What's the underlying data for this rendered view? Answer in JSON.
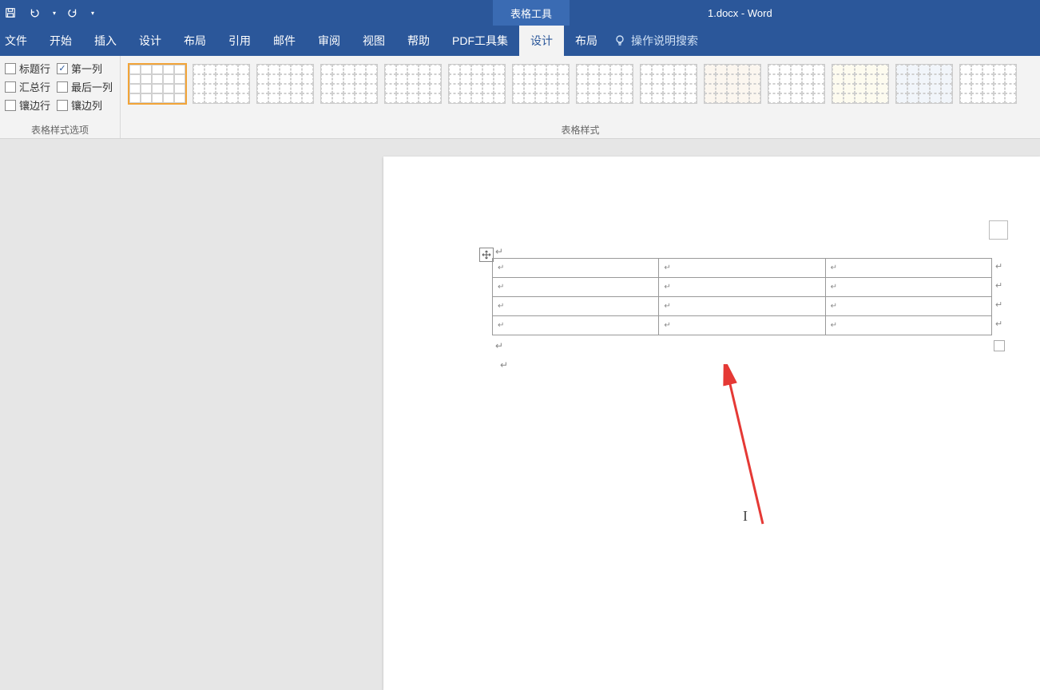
{
  "titlebar": {
    "context_tab": "表格工具",
    "doc_title": "1.docx  -  Word"
  },
  "ribbon": {
    "tabs": {
      "file": "文件",
      "home": "开始",
      "insert": "插入",
      "design": "设计",
      "layout": "布局",
      "references": "引用",
      "mailings": "邮件",
      "review": "审阅",
      "view": "视图",
      "help": "帮助",
      "pdf": "PDF工具集",
      "table_design": "设计",
      "table_layout": "布局"
    },
    "tell_me": "操作说明搜索",
    "style_options": {
      "header_row": "标题行",
      "first_column": "第一列",
      "total_row": "汇总行",
      "last_column": "最后一列",
      "banded_rows": "镶边行",
      "banded_columns": "镶边列",
      "group_label": "表格样式选项"
    },
    "table_styles": {
      "group_label": "表格样式"
    }
  },
  "document": {
    "cell_mark": "↵",
    "caret": "I"
  },
  "checkboxes": {
    "header_row": true,
    "first_column": true,
    "total_row": false,
    "last_column": false,
    "banded_rows": false,
    "banded_columns": false
  }
}
